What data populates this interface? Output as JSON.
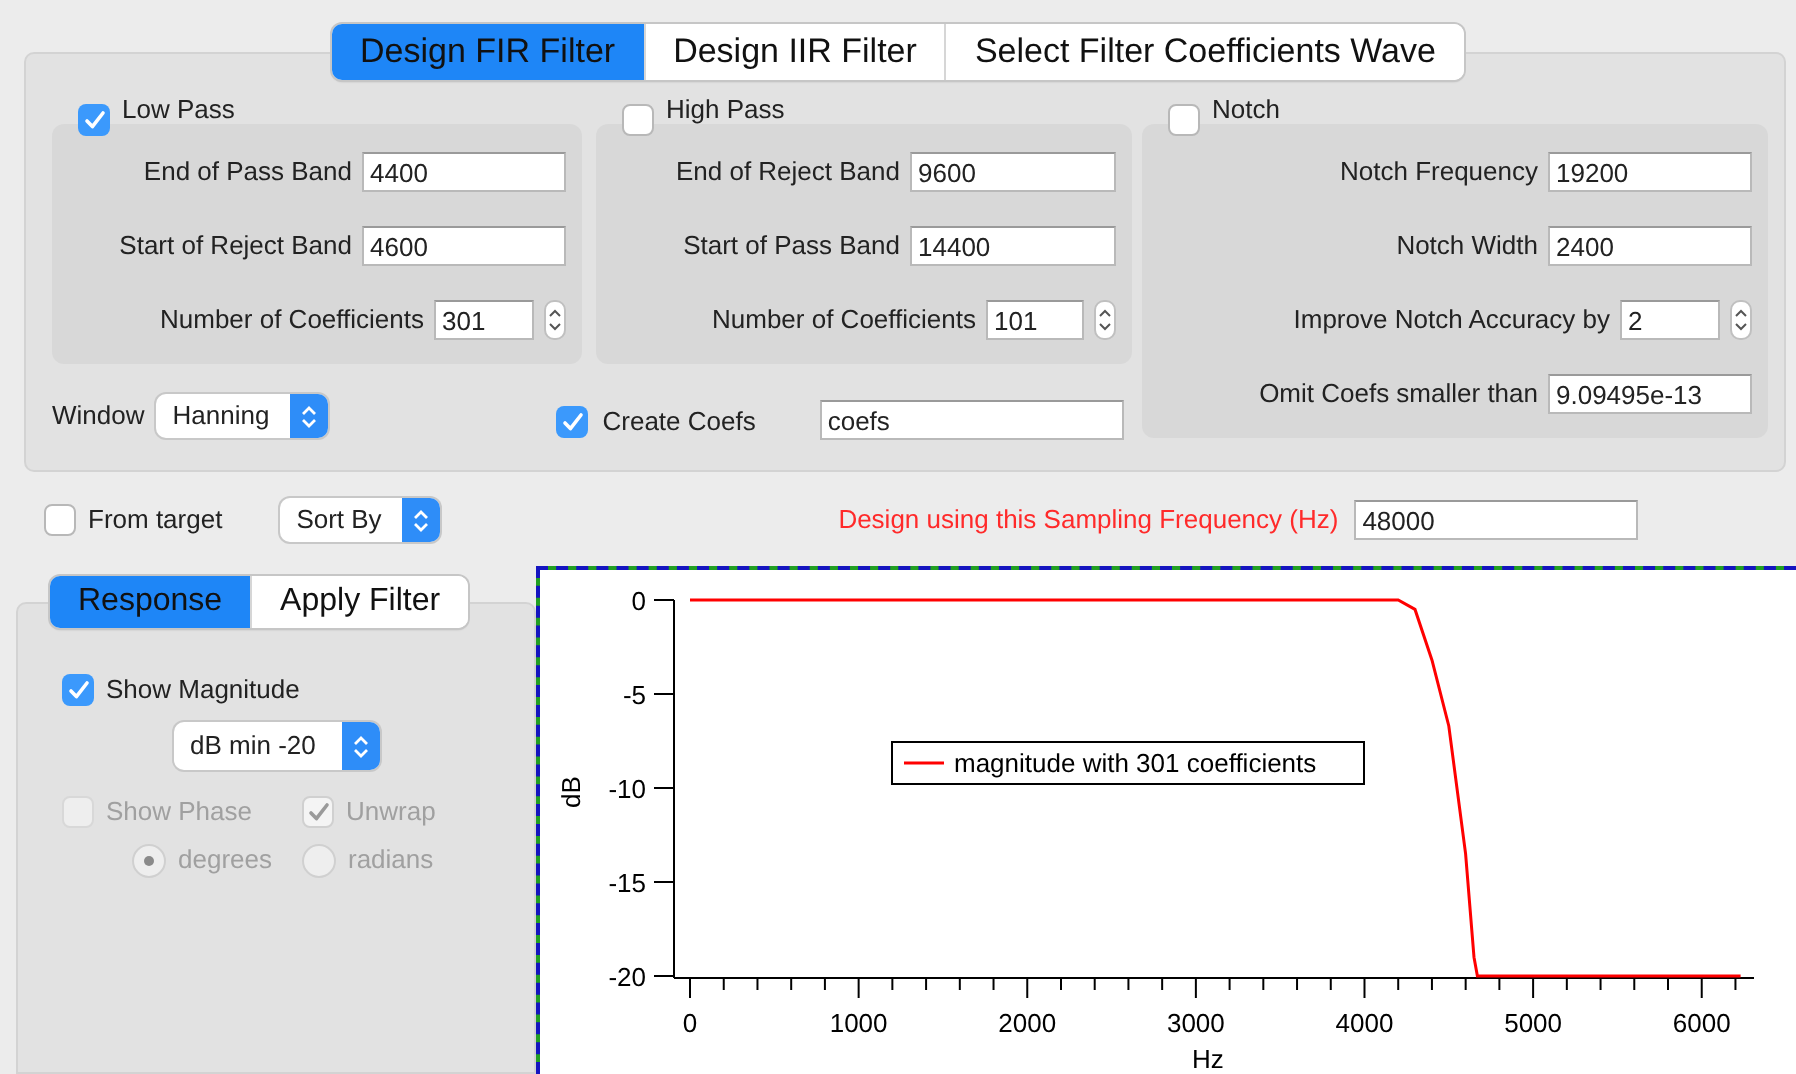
{
  "tabs": [
    {
      "label": "Design FIR Filter",
      "selected": true
    },
    {
      "label": "Design IIR Filter",
      "selected": false
    },
    {
      "label": "Select Filter Coefficients Wave",
      "selected": false
    }
  ],
  "groups": [
    {
      "label": "Low Pass",
      "checked": true,
      "fields": [
        {
          "kind": "text",
          "label": "End of Pass Band",
          "value": "4400"
        },
        {
          "kind": "text",
          "label": "Start of Reject Band",
          "value": "4600"
        },
        {
          "kind": "stepper",
          "label": "Number of Coefficients",
          "value": "301"
        }
      ]
    },
    {
      "label": "High Pass",
      "checked": false,
      "fields": [
        {
          "kind": "text",
          "label": "End of Reject Band",
          "value": "9600"
        },
        {
          "kind": "text",
          "label": "Start of Pass Band",
          "value": "14400"
        },
        {
          "kind": "stepper",
          "label": "Number of Coefficients",
          "value": "101"
        }
      ]
    },
    {
      "label": "Notch",
      "checked": false,
      "fields": [
        {
          "kind": "text",
          "label": "Notch Frequency",
          "value": "19200"
        },
        {
          "kind": "text",
          "label": "Notch Width",
          "value": "2400"
        },
        {
          "kind": "stepper",
          "label": "Improve Notch Accuracy by",
          "value": "2"
        },
        {
          "kind": "text",
          "label": "Omit Coefs smaller than",
          "value": "9.09495e-13"
        }
      ]
    }
  ],
  "window": {
    "label": "Window",
    "value": "Hanning"
  },
  "create_coefs": {
    "label": "Create Coefs",
    "checked": true,
    "value": "coefs"
  },
  "from_target": {
    "label": "From target",
    "checked": false
  },
  "sort_by": {
    "value": "Sort By"
  },
  "sampling": {
    "label": "Design using this Sampling Frequency (Hz)",
    "value": "48000"
  },
  "side_tabs": [
    {
      "label": "Response",
      "selected": true
    },
    {
      "label": "Apply Filter",
      "selected": false
    }
  ],
  "show_magnitude": {
    "label": "Show Magnitude",
    "checked": true
  },
  "db_min": {
    "value": "dB min -20"
  },
  "show_phase": {
    "label": "Show Phase",
    "checked": false,
    "disabled": true
  },
  "unwrap": {
    "label": "Unwrap",
    "checked": true,
    "disabled": true
  },
  "units": [
    {
      "label": "degrees",
      "selected": true,
      "disabled": true
    },
    {
      "label": "radians",
      "selected": false,
      "disabled": true
    }
  ],
  "chart": {
    "chart_data": {
      "type": "line",
      "xlabel": "Hz",
      "ylabel": "dB",
      "x": [
        0,
        1000,
        2000,
        3000,
        4000,
        4200,
        4300,
        4400,
        4500,
        4600,
        4650,
        4670,
        5000,
        6000,
        6230
      ],
      "series": [
        {
          "name": "magnitude with 301 coefficients",
          "color": "#ff0000",
          "values": [
            0,
            0,
            0,
            0,
            0,
            0,
            -0.5,
            -3.2,
            -6.7,
            -13.5,
            -19,
            -20,
            -20,
            -20,
            -20
          ]
        }
      ],
      "xlim": [
        -95,
        6310
      ],
      "ylim": [
        -20,
        0
      ],
      "xticks": [
        0,
        1000,
        2000,
        3000,
        4000,
        5000,
        6000
      ],
      "yticks": [
        0,
        -5,
        -10,
        -15,
        -20
      ]
    }
  }
}
